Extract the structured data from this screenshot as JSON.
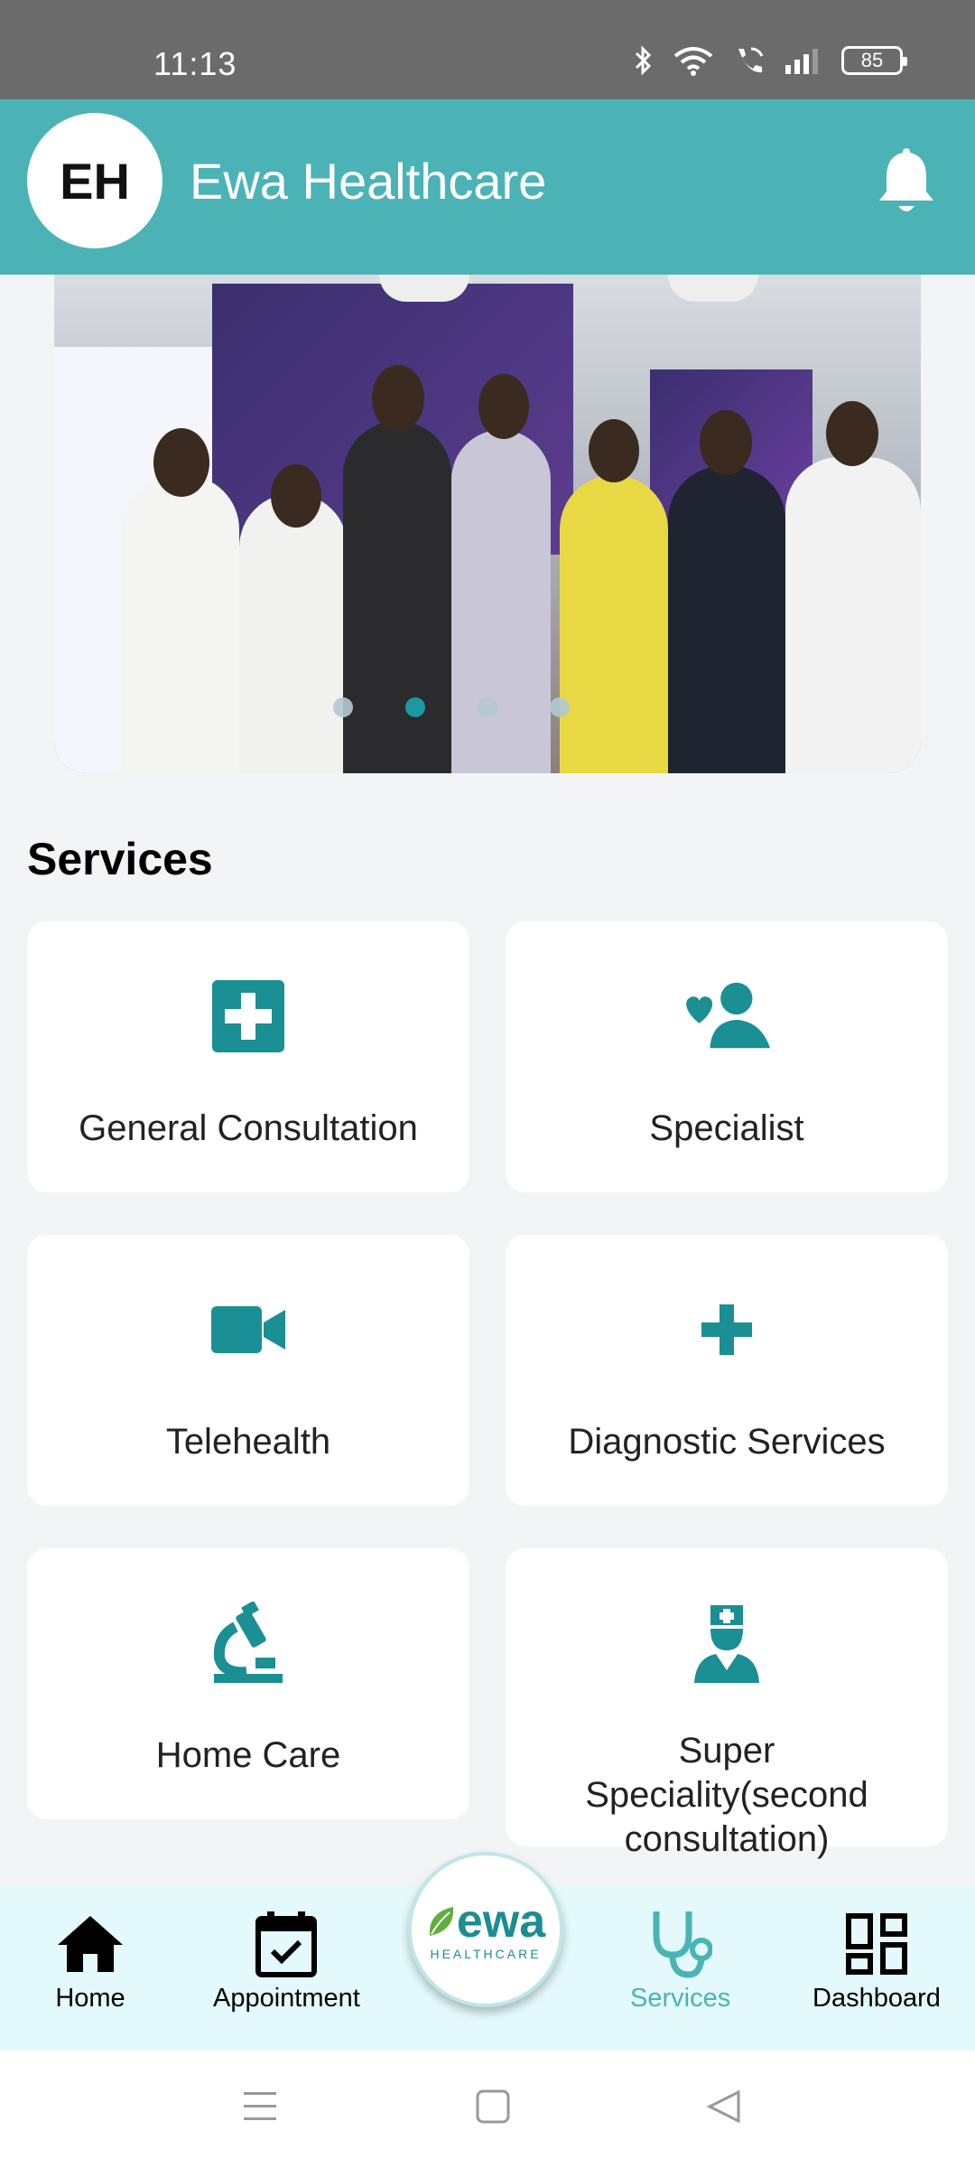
{
  "status_bar": {
    "time": "11:13",
    "battery": "85"
  },
  "header": {
    "avatar_initials": "EH",
    "title": "Ewa Healthcare",
    "accent_color": "#4bb3b5"
  },
  "banner": {
    "slides_count": 4,
    "active_slide": 2
  },
  "services": {
    "title": "Services",
    "icon_color": "#1a8f94",
    "items": [
      {
        "label": "General Consultation",
        "icon": "medical-cross-square-icon"
      },
      {
        "label": "Specialist",
        "icon": "user-heart-icon"
      },
      {
        "label": "Telehealth",
        "icon": "video-camera-icon"
      },
      {
        "label": "Diagnostic Services",
        "icon": "plus-icon"
      },
      {
        "label": "Home Care",
        "icon": "microscope-icon"
      },
      {
        "label": "Super Speciality(second consultation)",
        "icon": "doctor-icon"
      }
    ]
  },
  "bottom_nav": {
    "items": [
      {
        "label": "Home",
        "icon": "home-icon"
      },
      {
        "label": "Appointment",
        "icon": "calendar-check-icon"
      },
      {
        "label": "Services",
        "icon": "stethoscope-icon",
        "active": true
      },
      {
        "label": "Dashboard",
        "icon": "dashboard-icon"
      }
    ],
    "logo_word": "ewa",
    "logo_sub": "HEALTHCARE"
  }
}
